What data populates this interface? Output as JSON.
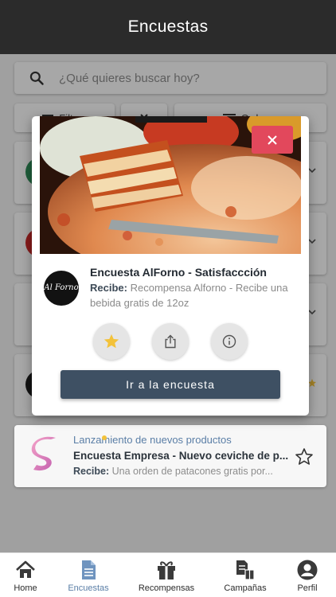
{
  "header": {
    "title": "Encuestas"
  },
  "search": {
    "placeholder": "¿Qué quieres buscar hoy?"
  },
  "filters": {
    "filter_label": "Filtros",
    "order_label": "Ordenar"
  },
  "visible_card": {
    "tag": "Lanzamiento de nuevos productos",
    "title": "Encuesta Empresa - Nuevo ceviche de p...",
    "reward_label": "Recibe:",
    "reward_text": "Una orden de patacones gratis por..."
  },
  "modal": {
    "title": "Encuesta AlForno - Satisfaccción",
    "reward_label": "Recibe:",
    "reward_text": "Recompensa Alforno - Recibe una bebida gratis de 12oz",
    "brand_name": "Al Forno",
    "action_button": "Ir a la encuesta",
    "actions": [
      "star-icon",
      "share-icon",
      "info-icon"
    ]
  },
  "nav": {
    "items": [
      {
        "label": "Home",
        "icon": "home-icon"
      },
      {
        "label": "Encuestas",
        "icon": "document-icon",
        "active": true
      },
      {
        "label": "Recompensas",
        "icon": "gift-icon"
      },
      {
        "label": "Campañas",
        "icon": "campaign-icon"
      },
      {
        "label": "Perfil",
        "icon": "profile-icon"
      }
    ]
  },
  "colors": {
    "header": "#2b2b2b",
    "accent": "#5a7ea6",
    "close": "#e2485c",
    "primary_button": "#3e5063",
    "star": "#f3c23a"
  }
}
